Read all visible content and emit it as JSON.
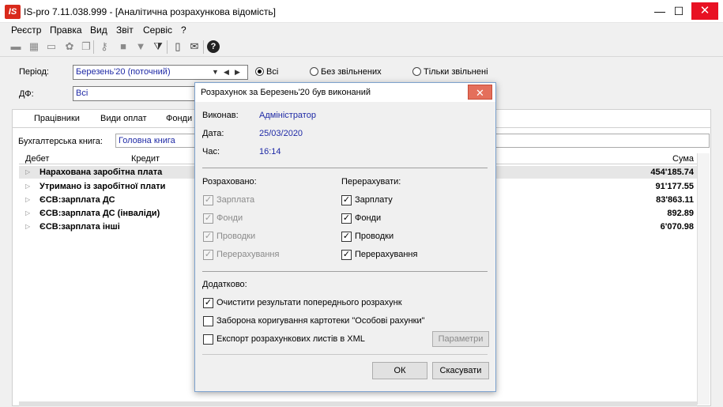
{
  "window": {
    "logo_text": "IS",
    "title": "IS-pro 7.11.038.999 - [Аналітична розрахункова відомість]"
  },
  "menu": [
    "Реєстр",
    "Правка",
    "Вид",
    "Звіт",
    "Сервіс",
    "?"
  ],
  "filters": {
    "period_label": "Період:",
    "period_value": "Березень'20 (поточний)",
    "radio_all": "Всі",
    "radio_without_dismissed": "Без звільнених",
    "radio_only_dismissed": "Тільки звільнені",
    "df_label": "ДФ:",
    "df_value": "Всі"
  },
  "tabs": [
    "Працівники",
    "Види оплат",
    "Фонди"
  ],
  "book": {
    "label": "Бухгалтерська книга:",
    "value": "Головна книга"
  },
  "table": {
    "col_debit": "Дебет",
    "col_credit": "Кредит",
    "col_sum": "Сума",
    "rows": [
      {
        "name": "Нарахована заробітна плата",
        "sum": "454'185.74"
      },
      {
        "name": "Утримано із заробітної плати",
        "sum": "91'177.55"
      },
      {
        "name": "ЄСВ:зарплата ДС",
        "sum": "83'863.11"
      },
      {
        "name": "ЄСВ:зарплата ДС (інваліди)",
        "sum": "892.89"
      },
      {
        "name": "ЄСВ:зарплата інші",
        "sum": "6'070.98"
      }
    ]
  },
  "dialog": {
    "title": "Розрахунок за Березень'20 був виконаний",
    "executed_label": "Виконав:",
    "executed_value": "Адміністратор",
    "date_label": "Дата:",
    "date_value": "25/03/2020",
    "time_label": "Час:",
    "time_value": "16:14",
    "calculated_label": "Розраховано:",
    "calculated": [
      "Зарплата",
      "Фонди",
      "Проводки",
      "Перерахування"
    ],
    "recalc_label": "Перерахувати:",
    "recalc": [
      "Зарплату",
      "Фонди",
      "Проводки",
      "Перерахування"
    ],
    "extra_label": "Додатково:",
    "extra_clear": "Очистити результати попереднього розрахунк",
    "extra_forbid": "Заборона коригування картотеки \"Особові рахунки\"",
    "extra_export": "Експорт розрахункових листів в XML",
    "params_button": "Параметри",
    "ok_button": "ОК",
    "cancel_button": "Скасувати"
  }
}
